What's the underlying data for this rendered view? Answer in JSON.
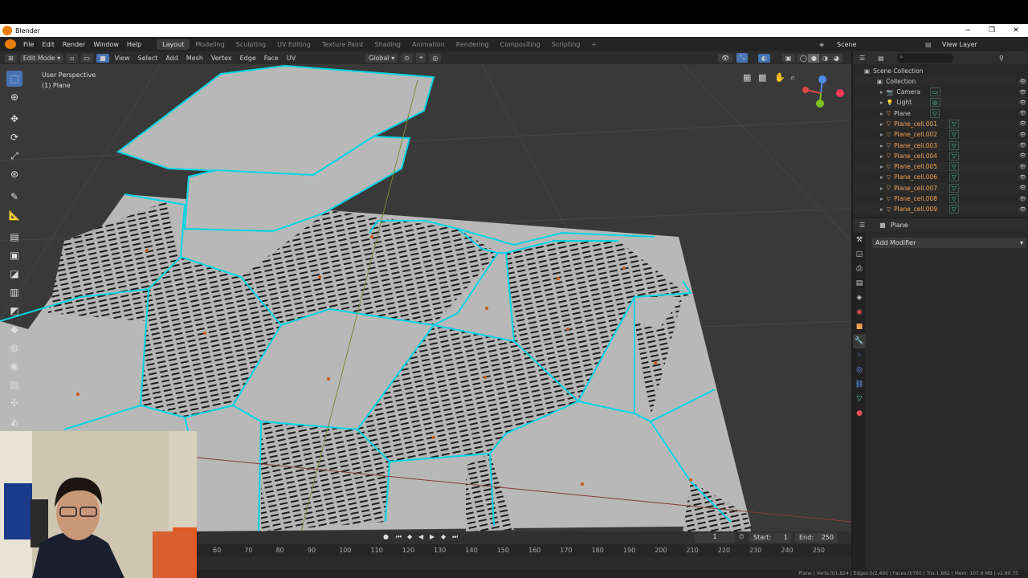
{
  "window": {
    "title": "Blender",
    "minimize": "−",
    "maximize": "❐",
    "close": "✕"
  },
  "menu": {
    "items": [
      "File",
      "Edit",
      "Render",
      "Window",
      "Help"
    ],
    "workspaces": [
      "Layout",
      "Modeling",
      "Sculpting",
      "UV Editing",
      "Texture Paint",
      "Shading",
      "Animation",
      "Rendering",
      "Compositing",
      "Scripting"
    ],
    "active_workspace": "Layout",
    "add_tab": "+",
    "scene_label": "Scene",
    "view_layer_label": "View Layer"
  },
  "viewport_header": {
    "mode": "Edit Mode",
    "items": [
      "View",
      "Select",
      "Add",
      "Mesh",
      "Vertex",
      "Edge",
      "Face",
      "UV"
    ],
    "orientation": "Global"
  },
  "viewport": {
    "perspective": "User Perspective",
    "object": "(1) Plane"
  },
  "outliner": {
    "title": "Scene Collection",
    "collection": "Collection",
    "objects": [
      {
        "name": "Camera",
        "selected": false
      },
      {
        "name": "Light",
        "selected": false
      },
      {
        "name": "Plane",
        "selected": false
      },
      {
        "name": "Plane_cell.001",
        "selected": true
      },
      {
        "name": "Plane_cell.002",
        "selected": true
      },
      {
        "name": "Plane_cell.003",
        "selected": true
      },
      {
        "name": "Plane_cell.004",
        "selected": true
      },
      {
        "name": "Plane_cell.005",
        "selected": true
      },
      {
        "name": "Plane_cell.006",
        "selected": true
      },
      {
        "name": "Plane_cell.007",
        "selected": true
      },
      {
        "name": "Plane_cell.008",
        "selected": true
      },
      {
        "name": "Plane_cell.009",
        "selected": true
      }
    ]
  },
  "properties": {
    "object_name": "Plane",
    "add_modifier": "Add Modifier"
  },
  "timeline": {
    "current_frame": "1",
    "start_label": "Start:",
    "start": "1",
    "end_label": "End:",
    "end": "250",
    "ticks": [
      "60",
      "70",
      "80",
      "90",
      "100",
      "110",
      "120",
      "130",
      "140",
      "150",
      "160",
      "170",
      "180",
      "190",
      "200",
      "210",
      "220",
      "230",
      "240",
      "250"
    ]
  },
  "status": "Plane | Verts:0/1,824 | Edges:0/2,490 | Faces:0/760 | Tris:1,882 | Mem: 107.6 MB | v2.80.75",
  "colors": {
    "accent": "#4772b3",
    "edge_highlight": "#00d5e6",
    "selected_object": "#f0a254",
    "blender_orange": "#e87d0d"
  }
}
